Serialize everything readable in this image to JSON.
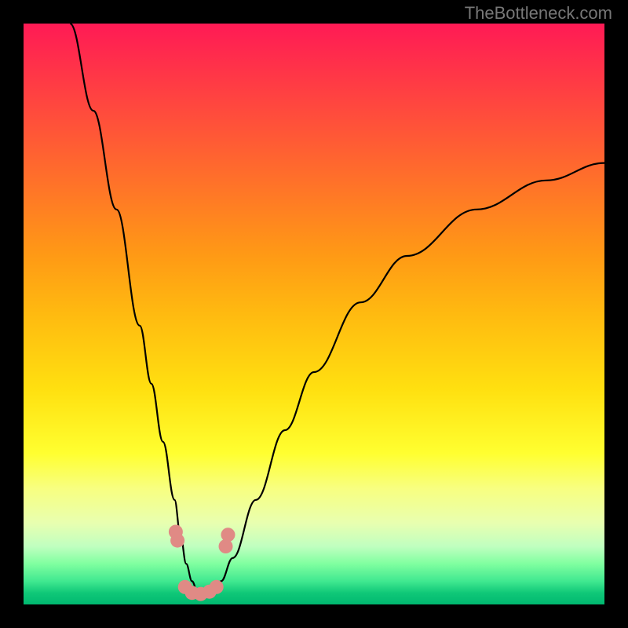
{
  "watermark": "TheBottleneck.com",
  "chart_data": {
    "type": "line",
    "title": "",
    "xlabel": "",
    "ylabel": "",
    "xlim": [
      0,
      100
    ],
    "ylim": [
      0,
      100
    ],
    "grid": false,
    "series": [
      {
        "name": "bottleneck-curve",
        "color": "#000000",
        "x": [
          8,
          12,
          16,
          20,
          22,
          24,
          26,
          27,
          28,
          29,
          30,
          31,
          32,
          33,
          34,
          36,
          40,
          45,
          50,
          58,
          66,
          78,
          90,
          100
        ],
        "y": [
          100,
          85,
          68,
          48,
          38,
          28,
          18,
          12,
          7,
          4,
          2,
          2,
          2,
          3,
          4,
          8,
          18,
          30,
          40,
          52,
          60,
          68,
          73,
          76
        ]
      }
    ],
    "markers": [
      {
        "x": 26.2,
        "y": 12.5
      },
      {
        "x": 26.5,
        "y": 11.0
      },
      {
        "x": 27.8,
        "y": 3.0
      },
      {
        "x": 29.0,
        "y": 2.0
      },
      {
        "x": 30.5,
        "y": 1.8
      },
      {
        "x": 32.0,
        "y": 2.2
      },
      {
        "x": 33.2,
        "y": 3.0
      },
      {
        "x": 34.8,
        "y": 10.0
      },
      {
        "x": 35.2,
        "y": 12.0
      }
    ],
    "background_gradient": {
      "top": "#ff1a55",
      "mid": "#ffe010",
      "bottom": "#00b870"
    }
  }
}
